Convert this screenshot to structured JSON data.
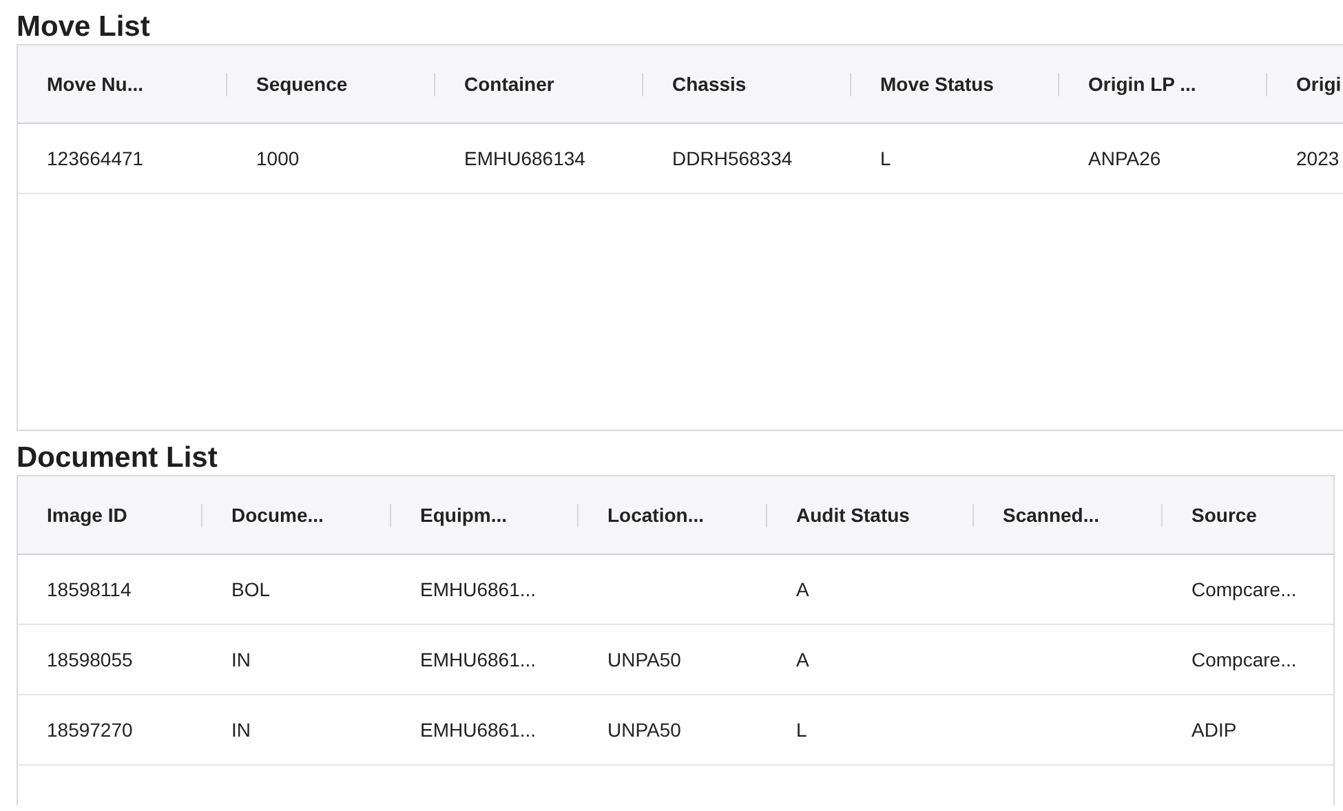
{
  "move_list": {
    "title": "Move List",
    "columns": [
      "Move Nu...",
      "Sequence",
      "Container",
      "Chassis",
      "Move Status",
      "Origin LP ...",
      "Origi"
    ],
    "rows": [
      [
        "123664471",
        "1000",
        "EMHU686134",
        "DDRH568334",
        "L",
        "ANPA26",
        "2023"
      ]
    ]
  },
  "document_list": {
    "title": "Document List",
    "columns": [
      "Image ID",
      "Docume...",
      "Equipm...",
      "Location...",
      "Audit Status",
      "Scanned...",
      "Source"
    ],
    "rows": [
      [
        "18598114",
        "BOL",
        "EMHU6861...",
        null,
        "A",
        null,
        "Compcare..."
      ],
      [
        "18598055",
        "IN",
        "EMHU6861...",
        "UNPA50",
        "A",
        null,
        "Compcare..."
      ],
      [
        "18597270",
        "IN",
        "EMHU6861...",
        "UNPA50",
        "L",
        null,
        "ADIP"
      ]
    ]
  }
}
